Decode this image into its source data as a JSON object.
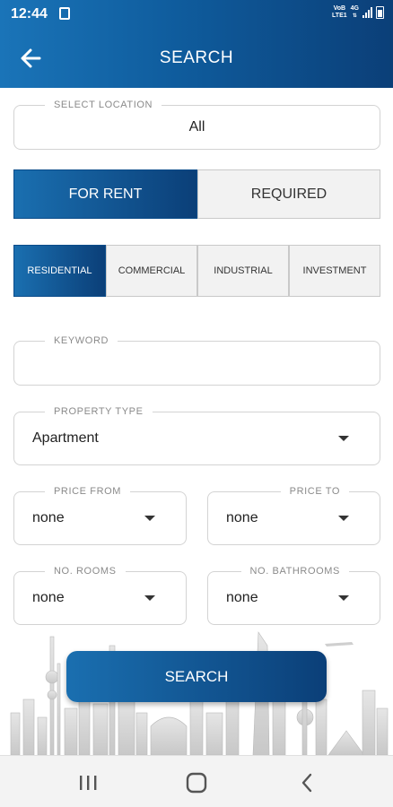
{
  "status_bar": {
    "time": "12:44",
    "network_line1": "VoB",
    "network_line2": "LTE1",
    "network_type": "4G"
  },
  "header": {
    "title": "SEARCH",
    "back_icon": "arrow-left-icon",
    "gradient_colors": [
      "#1a74b8",
      "#0b3f78"
    ]
  },
  "location": {
    "label": "SELECT LOCATION",
    "value": "All"
  },
  "listing_type_tabs": [
    {
      "label": "FOR RENT",
      "active": true
    },
    {
      "label": "REQUIRED",
      "active": false
    }
  ],
  "category_tabs": [
    {
      "label": "RESIDENTIAL",
      "active": true
    },
    {
      "label": "COMMERCIAL",
      "active": false
    },
    {
      "label": "INDUSTRIAL",
      "active": false
    },
    {
      "label": "INVESTMENT",
      "active": false
    }
  ],
  "keyword": {
    "label": "KEYWORD",
    "value": ""
  },
  "property_type": {
    "label": "PROPERTY TYPE",
    "value": "Apartment"
  },
  "price_from": {
    "label": "PRICE FROM",
    "value": "none"
  },
  "price_to": {
    "label": "PRICE TO",
    "value": "none"
  },
  "rooms": {
    "label": "NO. ROOMS",
    "value": "none"
  },
  "bathrooms": {
    "label": "NO. BATHROOMS",
    "value": "none"
  },
  "search_button": {
    "label": "SEARCH"
  },
  "nav_bar": {
    "icons": [
      "recent-apps-icon",
      "home-icon",
      "back-icon"
    ]
  },
  "accent_color": "#0b3f78"
}
